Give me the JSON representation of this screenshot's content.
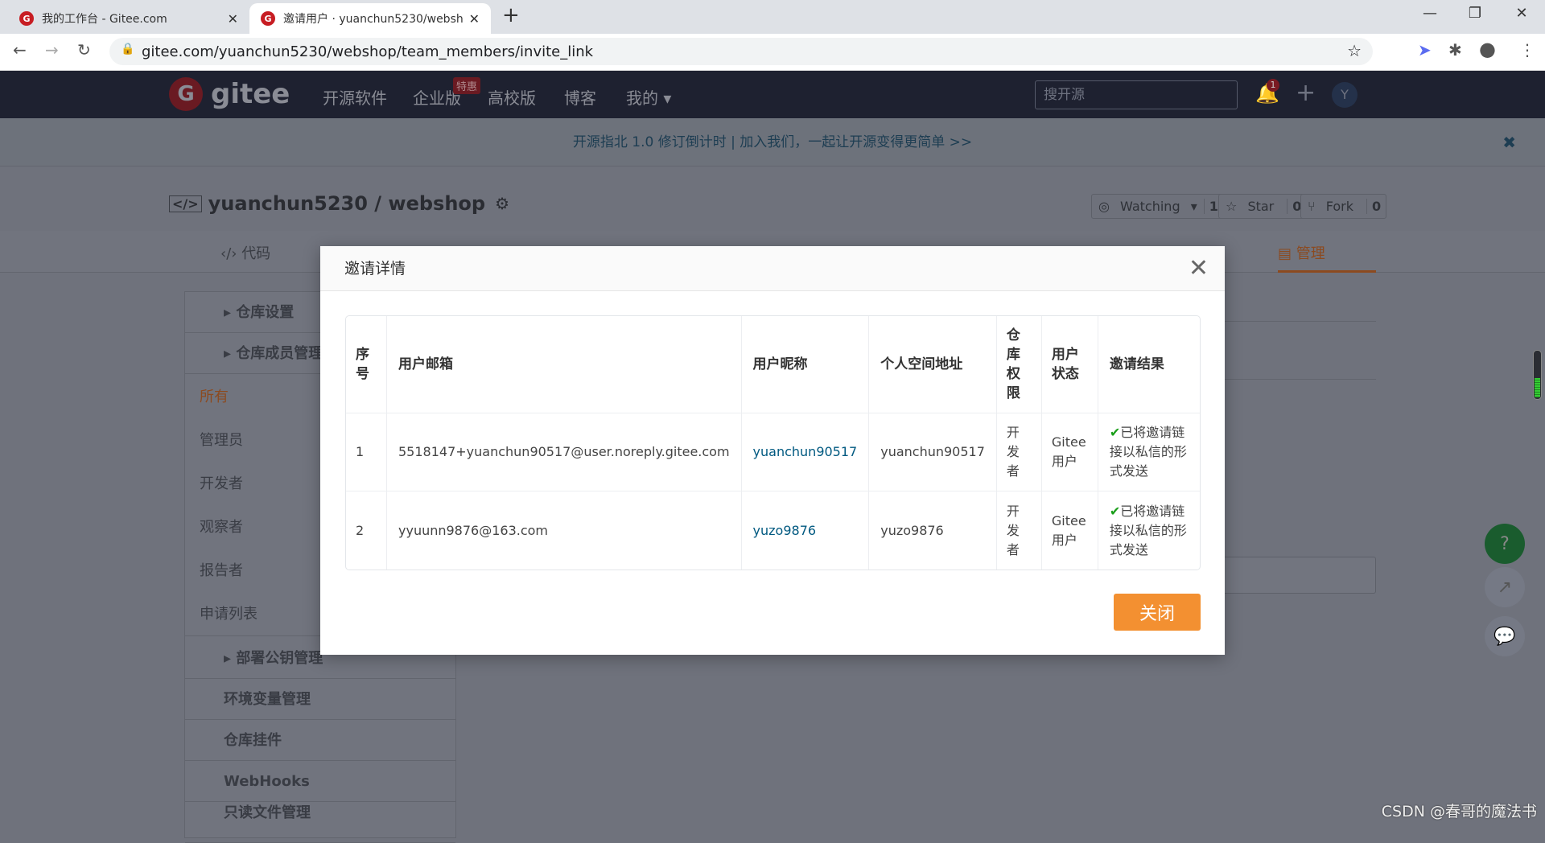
{
  "browser": {
    "tabs": [
      {
        "title": "我的工作台 - Gitee.com",
        "active": false
      },
      {
        "title": "邀请用户 · yuanchun5230/webshop",
        "active": true
      }
    ],
    "new_tab": "+",
    "url": "gitee.com/yuanchun5230/webshop/team_members/invite_link"
  },
  "topnav": {
    "logo": "gitee",
    "items": [
      "开源软件",
      "企业版",
      "高校版",
      "博客",
      "我的"
    ],
    "badge": "特惠",
    "search_placeholder": "搜开源",
    "notification_count": "1",
    "avatar": "Y"
  },
  "banner": {
    "text": "开源指北 1.0 修订倒计时 | 加入我们，一起让开源变得更简单 >>"
  },
  "repo": {
    "title": "yuanchun5230 / webshop",
    "watching": {
      "label": "Watching",
      "count": "1"
    },
    "star": {
      "label": "Star",
      "count": "0"
    },
    "fork": {
      "label": "Fork",
      "count": "0"
    }
  },
  "repo_tabs": {
    "code": "代码",
    "manage": "管理"
  },
  "sidebar": {
    "groups_top": [
      "仓库设置",
      "仓库成员管理"
    ],
    "member_items": [
      {
        "label": "所有",
        "active": true
      },
      {
        "label": "管理员"
      },
      {
        "label": "开发者"
      },
      {
        "label": "观察者"
      },
      {
        "label": "报告者"
      },
      {
        "label": "申请列表"
      }
    ],
    "groups_bottom": [
      "部署公钥管理",
      "环境变量管理",
      "仓库挂件",
      "WebHooks",
      "只读文件管理"
    ]
  },
  "modal": {
    "title": "邀请详情",
    "columns": [
      "序号",
      "用户邮箱",
      "用户昵称",
      "个人空间地址",
      "仓库权限",
      "用户状态",
      "邀请结果"
    ],
    "rows": [
      {
        "index": "1",
        "email": "5518147+yuanchun90517@user.noreply.gitee.com",
        "nickname": "yuanchun90517",
        "space": "yuanchun90517",
        "permission": "开发者",
        "status": "Gitee用户",
        "result": "已将邀请链接以私信的形式发送"
      },
      {
        "index": "2",
        "email": "yyuunn9876@163.com",
        "nickname": "yuzo9876",
        "space": "yuzo9876",
        "permission": "开发者",
        "status": "Gitee用户",
        "result": "已将邀请链接以私信的形式发送"
      }
    ],
    "close_label": "关闭"
  },
  "watermark": "CSDN @春哥的魔法书",
  "colors": {
    "accent": "#f39031",
    "link": "#005980",
    "nav": "#1e2233",
    "success": "#1a9e1a",
    "brand": "#c71d23"
  }
}
